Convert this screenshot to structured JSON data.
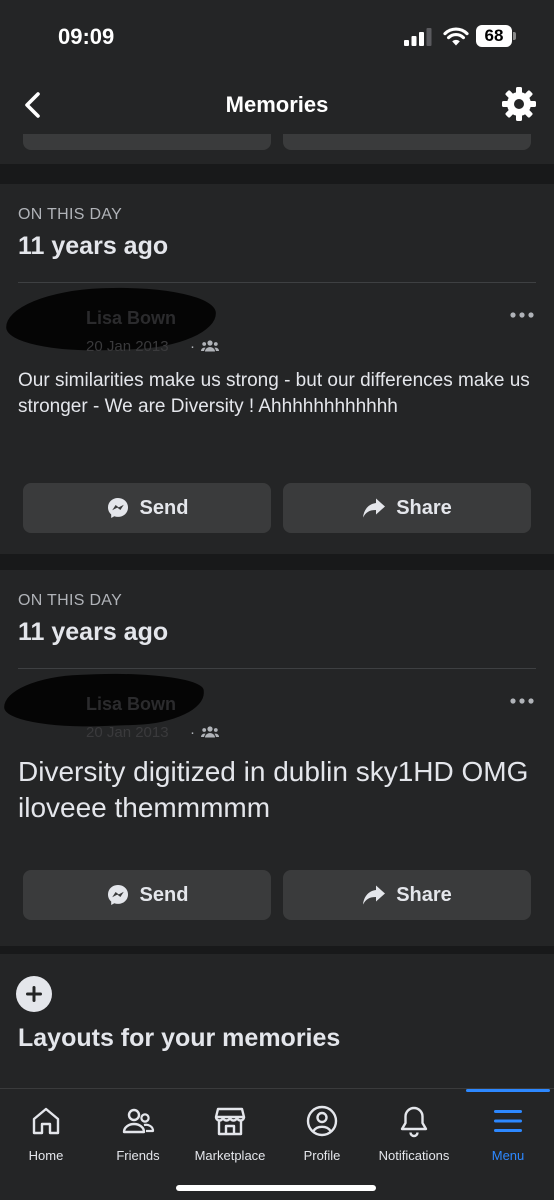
{
  "status_bar": {
    "time": "09:09",
    "battery": "68"
  },
  "header": {
    "title": "Memories"
  },
  "memories": [
    {
      "eyebrow": "ON THIS DAY",
      "years_ago": "11 years ago",
      "author": "Lisa Bown",
      "date": "20 Jan 2013",
      "separator": "·",
      "text": "Our similarities make us strong - but our differences make us stronger - We are Diversity ! Ahhhhhhhhhhhh",
      "send_label": "Send",
      "share_label": "Share"
    },
    {
      "eyebrow": "ON THIS DAY",
      "years_ago": "11 years ago",
      "author": "Lisa Bown",
      "date": "20 Jan 2013",
      "separator": "·",
      "text": "Diversity digitized in dublin sky1HD OMG iloveee themmmmm",
      "send_label": "Send",
      "share_label": "Share"
    }
  ],
  "layouts": {
    "title": "Layouts for your memories",
    "icon": "plus-icon"
  },
  "bottom_nav": {
    "items": [
      {
        "label": "Home",
        "icon": "home-icon",
        "active": false
      },
      {
        "label": "Friends",
        "icon": "friends-icon",
        "active": false
      },
      {
        "label": "Marketplace",
        "icon": "marketplace-icon",
        "active": false
      },
      {
        "label": "Profile",
        "icon": "profile-icon",
        "active": false
      },
      {
        "label": "Notifications",
        "icon": "bell-icon",
        "active": false
      },
      {
        "label": "Menu",
        "icon": "menu-icon",
        "active": true
      }
    ]
  },
  "colors": {
    "background": "#18191a",
    "card": "#242526",
    "button": "#3a3b3c",
    "text": "#e4e6eb",
    "secondary_text": "#b0b3b8",
    "accent": "#2d88ff"
  }
}
